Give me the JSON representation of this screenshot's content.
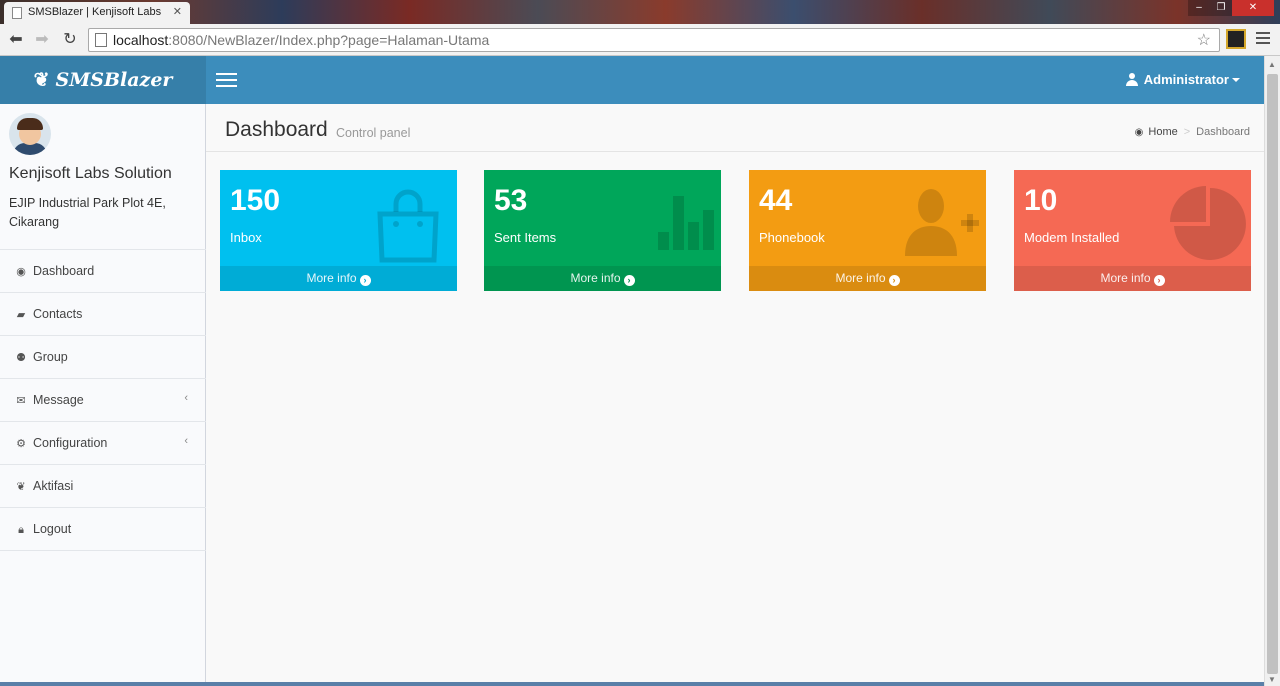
{
  "browser": {
    "tab_title": "SMSBlazer | Kenjisoft Labs",
    "url_host": "localhost",
    "url_rest": ":8080/NewBlazer/Index.php?page=Halaman-Utama"
  },
  "header": {
    "logo": "SMSBlazer",
    "user": "Administrator"
  },
  "sidebar": {
    "company": "Kenjisoft Labs Solution",
    "address": "EJIP Industrial Park Plot 4E, Cikarang",
    "items": [
      {
        "label": "Dashboard",
        "icon": "dashboard-icon"
      },
      {
        "label": "Contacts",
        "icon": "book-icon"
      },
      {
        "label": "Group",
        "icon": "users-icon"
      },
      {
        "label": "Message",
        "icon": "envelope-icon"
      },
      {
        "label": "Configuration",
        "icon": "gears-icon"
      },
      {
        "label": "Aktifasi",
        "icon": "leaf-icon"
      },
      {
        "label": "Logout",
        "icon": "lock-icon"
      }
    ]
  },
  "content": {
    "title": "Dashboard",
    "subtitle": "Control panel",
    "breadcrumb_home": "Home",
    "breadcrumb_current": "Dashboard"
  },
  "boxes": [
    {
      "value": "150",
      "label": "Inbox",
      "more": "More info",
      "color": "#00c0ef",
      "icon": "shopping-bag-icon"
    },
    {
      "value": "53",
      "label": "Sent Items",
      "more": "More info",
      "color": "#00a65a",
      "icon": "bar-chart-icon"
    },
    {
      "value": "44",
      "label": "Phonebook",
      "more": "More info",
      "color": "#f39c12",
      "icon": "user-add-icon"
    },
    {
      "value": "10",
      "label": "Modem Installed",
      "more": "More info",
      "color": "#f56954",
      "icon": "pie-chart-icon"
    }
  ]
}
